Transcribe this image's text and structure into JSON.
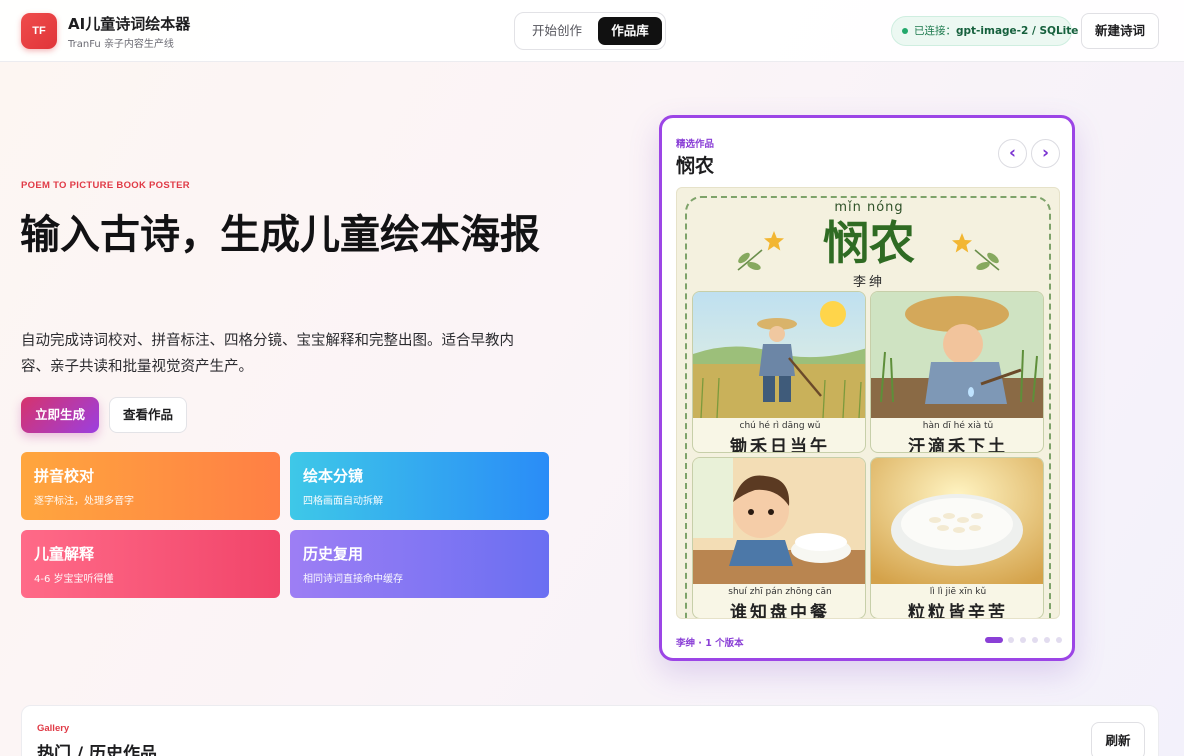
{
  "header": {
    "logo_text": "TF",
    "app_title": "AI儿童诗词绘本器",
    "app_subtitle": "TranFu 亲子内容生产线",
    "tabs": [
      {
        "label": "开始创作",
        "active": false
      },
      {
        "label": "作品库",
        "active": true
      }
    ],
    "status_prefix": "已连接：",
    "status_value": "gpt-image-2 / SQLite",
    "new_poem_label": "新建诗词"
  },
  "hero": {
    "eyebrow": "POEM TO PICTURE BOOK POSTER",
    "title": "输入古诗，生成儿童绘本海报",
    "description": "自动完成诗词校对、拼音标注、四格分镜、宝宝解释和完整出图。适合早教内容、亲子共读和批量视觉资产生产。",
    "primary_button": "立即生成",
    "secondary_button": "查看作品"
  },
  "feature_cards": [
    {
      "title": "拼音校对",
      "subtitle": "逐字标注，处理多音字",
      "color": "#ff8f42"
    },
    {
      "title": "绘本分镜",
      "subtitle": "四格画面自动拆解",
      "color": "#2fa8f2"
    },
    {
      "title": "儿童解释",
      "subtitle": "4-6 岁宝宝听得懂",
      "color": "#f4577a"
    },
    {
      "title": "历史复用",
      "subtitle": "相同诗词直接命中缓存",
      "color": "#8276f3"
    }
  ],
  "featured": {
    "label": "精选作品",
    "title": "悯农",
    "prev_icon": "‹",
    "next_icon": "›",
    "poster": {
      "pinyin": "mǐn nóng",
      "title": "悯农",
      "author": "李绅",
      "panels": [
        {
          "pinyin": "chú hé rì dāng wǔ",
          "text": "锄禾日当午",
          "scene": "farmer-hoeing"
        },
        {
          "pinyin": "hàn dī hé xià tǔ",
          "text": "汗滴禾下土",
          "scene": "sweat-dripping"
        },
        {
          "pinyin": "shuí zhī pán zhōng cān",
          "text": "谁知盘中餐",
          "scene": "child-with-rice"
        },
        {
          "pinyin": "lì lì jiē xīn kǔ",
          "text": "粒粒皆辛苦",
          "scene": "rice-bowl"
        }
      ]
    },
    "footer": "李绅 · 1 个版本",
    "pagination": {
      "total": 6,
      "active": 0
    }
  },
  "gallery": {
    "eyebrow": "Gallery",
    "title": "热门 / 历史作品",
    "refresh_label": "刷新"
  },
  "colors": {
    "accent_red": "#e03a46",
    "accent_purple": "#9c45e6",
    "status_green": "#22a86b"
  }
}
